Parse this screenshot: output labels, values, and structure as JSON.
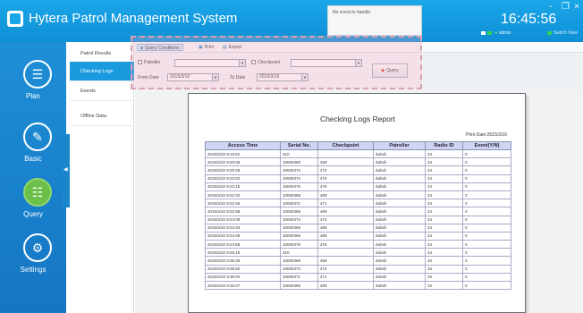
{
  "app": {
    "title": "Hytera Patrol Management System",
    "event_notice": "No event to handle.",
    "clock": "16:45:56",
    "window_controls": {
      "minimize": "-",
      "maximize": "❐",
      "close": "×"
    },
    "user": "admin",
    "switch_view": "Switch View"
  },
  "left_nav": [
    {
      "label": "Plan",
      "icon": "document-icon",
      "glyph": "☰",
      "active": false
    },
    {
      "label": "Basic",
      "icon": "pen-icon",
      "glyph": "✎",
      "active": false
    },
    {
      "label": "Query",
      "icon": "clipboard-icon",
      "glyph": "☷",
      "active": true
    },
    {
      "label": "Settings",
      "icon": "gear-icon",
      "glyph": "⚙",
      "active": false
    }
  ],
  "collapse_glyph": "◀",
  "sub_nav": [
    {
      "label": "Patrol Results",
      "active": false
    },
    {
      "label": "Checking Logs",
      "active": true
    },
    {
      "label": "Events",
      "active": false
    },
    {
      "label": "Offline Data",
      "active": false
    }
  ],
  "toolbar": {
    "query_conditions": "Query Conditions",
    "print": "Print",
    "export": "Export"
  },
  "conditions": {
    "patroller_label": "Patroller",
    "patroller_value": "",
    "checkpoint_label": "Checkpoint",
    "checkpoint_value": "",
    "from_date_label": "From Date",
    "from_date_value": "2015/3/10",
    "to_date_label": "To Date",
    "to_date_value": "2015/3/16",
    "query_button": "Query"
  },
  "report": {
    "title": "Checking Logs Report",
    "print_date": "Print Date:2015/3/16",
    "columns": [
      "Access Time",
      "Serial No.",
      "Checkpoint",
      "Patroller",
      "Radio ID",
      "Event(Y/N)"
    ],
    "rows": [
      [
        "2015/3/10 9:19:52",
        "310",
        "",
        "duheli",
        "24",
        "0"
      ],
      [
        "2015/3/10 9:20:08",
        "10000469",
        "469",
        "duheli",
        "24",
        "0"
      ],
      [
        "2015/3/10 9:20:28",
        "10000474",
        "474",
        "duheli",
        "24",
        "0"
      ],
      [
        "2015/3/10 9:22:02",
        "10000474",
        "474",
        "duheli",
        "24",
        "0"
      ],
      [
        "2015/3/10 9:22:15",
        "10000476",
        "476",
        "duheli",
        "24",
        "0"
      ],
      [
        "2015/3/10 9:22:33",
        "10000469",
        "469",
        "duheli",
        "24",
        "0"
      ],
      [
        "2015/3/10 9:22:45",
        "10000471",
        "471",
        "duheli",
        "24",
        "0"
      ],
      [
        "2015/3/10 9:22:58",
        "10000469",
        "469",
        "duheli",
        "24",
        "0"
      ],
      [
        "2015/3/10 9:24:09",
        "10000474",
        "474",
        "duheli",
        "24",
        "0"
      ],
      [
        "2015/3/10 9:24:33",
        "10000469",
        "469",
        "duheli",
        "24",
        "0"
      ],
      [
        "2015/3/10 9:24:49",
        "10000469",
        "469",
        "duheli",
        "24",
        "0"
      ],
      [
        "2015/3/10 9:24:58",
        "10000476",
        "476",
        "duheli",
        "24",
        "0"
      ],
      [
        "2015/3/10 9:25:18",
        "310",
        "",
        "duheli",
        "24",
        "0"
      ],
      [
        "2015/3/10 9:35:38",
        "10000469",
        "469",
        "duheli",
        "10",
        "0"
      ],
      [
        "2015/3/10 9:35:50",
        "10000474",
        "474",
        "duheli",
        "10",
        "0"
      ],
      [
        "2015/3/10 9:36:00",
        "10000471",
        "471",
        "duheli",
        "10",
        "0"
      ],
      [
        "2015/3/10 9:36:07",
        "10000469",
        "469",
        "duheli",
        "10",
        "0"
      ]
    ]
  }
}
